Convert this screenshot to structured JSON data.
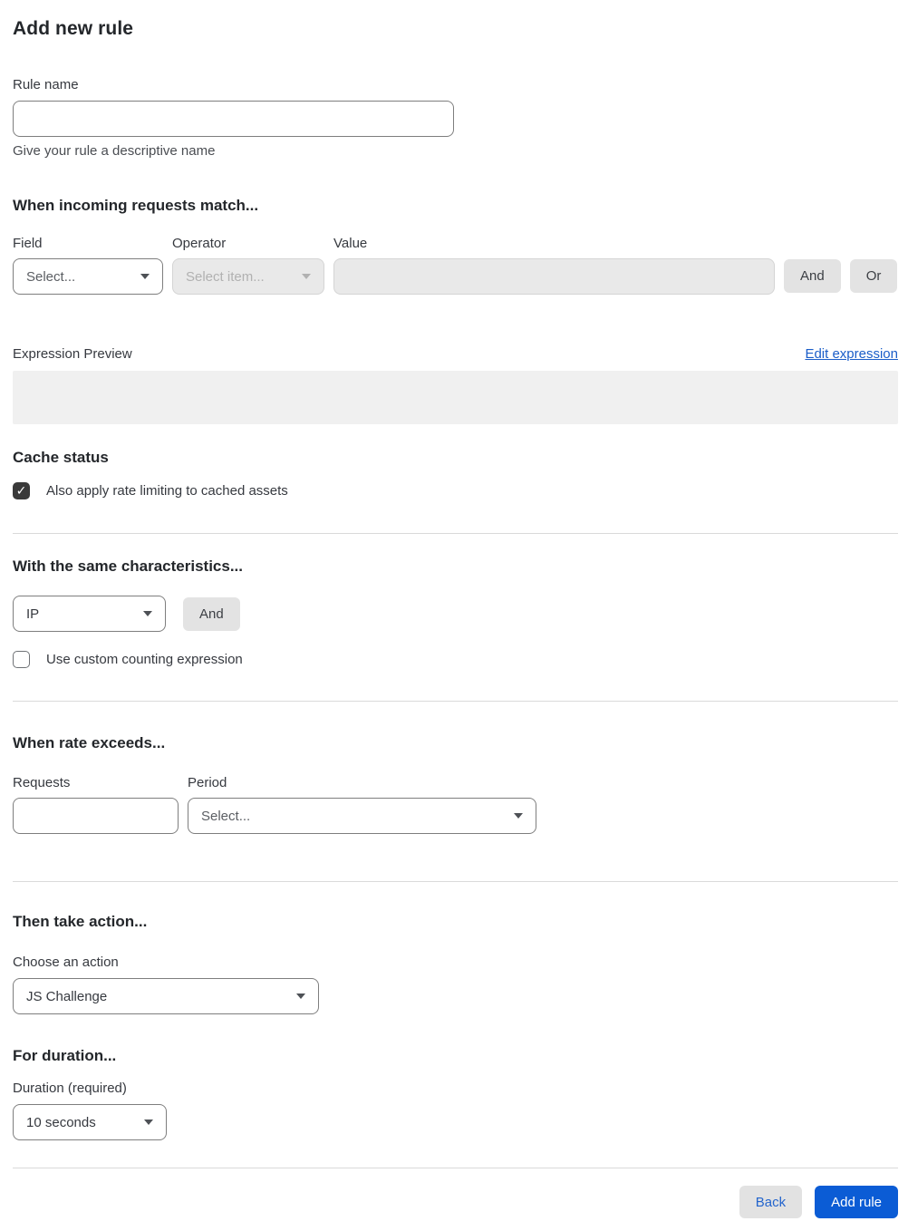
{
  "page": {
    "title": "Add new rule"
  },
  "rule_name": {
    "label": "Rule name",
    "value": "",
    "helper": "Give your rule a descriptive name"
  },
  "match": {
    "heading": "When incoming requests match...",
    "field": {
      "label": "Field",
      "selected": "Select..."
    },
    "operator": {
      "label": "Operator",
      "selected": "Select item..."
    },
    "value": {
      "label": "Value",
      "value": ""
    },
    "and_label": "And",
    "or_label": "Or",
    "expression_preview_label": "Expression Preview",
    "edit_expression_label": "Edit expression",
    "expression_value": ""
  },
  "cache": {
    "heading": "Cache status",
    "checkbox_label": "Also apply rate limiting to cached assets",
    "checked": true,
    "check_glyph": "✓"
  },
  "characteristics": {
    "heading": "With the same characteristics...",
    "selected": "IP",
    "and_label": "And",
    "checkbox_label": "Use custom counting expression",
    "checked": false
  },
  "rate": {
    "heading": "When rate exceeds...",
    "requests_label": "Requests",
    "requests_value": "",
    "period_label": "Period",
    "period_selected": "Select..."
  },
  "action": {
    "heading": "Then take action...",
    "label": "Choose an action",
    "selected": "JS Challenge"
  },
  "duration": {
    "heading": "For duration...",
    "label": "Duration (required)",
    "selected": "10 seconds"
  },
  "footer": {
    "back_label": "Back",
    "add_label": "Add rule"
  },
  "colors": {
    "primary_blue": "#0b5cd5",
    "link_blue": "#1a5dc8",
    "checkbox_checked": "#3a3a3a",
    "disabled_bg": "#e9e9e9",
    "preview_bg": "#f0f0f0"
  }
}
